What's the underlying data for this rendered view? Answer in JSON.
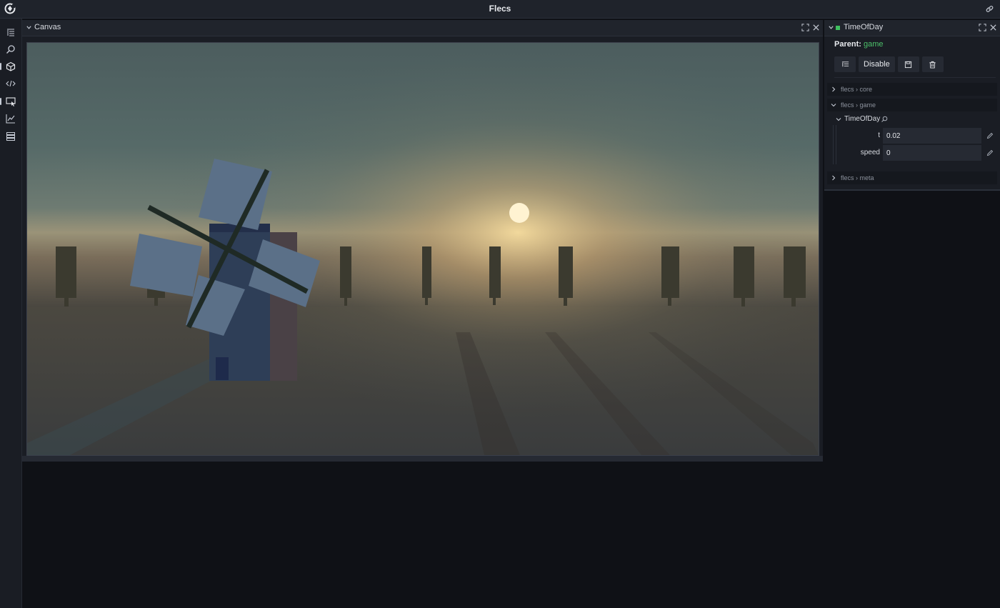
{
  "app": {
    "title": "Flecs"
  },
  "sidebar": {
    "items": [
      {
        "name": "tree-icon"
      },
      {
        "name": "search-icon"
      },
      {
        "name": "cube-icon",
        "active": true
      },
      {
        "name": "code-icon"
      },
      {
        "name": "cursor-icon",
        "active": true
      },
      {
        "name": "chart-icon"
      },
      {
        "name": "list-icon"
      }
    ]
  },
  "canvas_panel": {
    "title": "Canvas"
  },
  "inspector": {
    "title": "TimeOfDay",
    "status_color": "#3fbf5f",
    "parent_label": "Parent:",
    "parent_value": "game",
    "toolbar": {
      "disable_label": "Disable"
    },
    "sections": [
      {
        "module": "flecs",
        "name": "core",
        "expanded": false
      },
      {
        "module": "flecs",
        "name": "game",
        "expanded": true
      },
      {
        "module": "flecs",
        "name": "meta",
        "expanded": false
      }
    ],
    "section_labels": {
      "core": "flecs › core",
      "game": "flecs › game",
      "meta": "flecs › meta"
    },
    "component": {
      "name": "TimeOfDay",
      "fields": [
        {
          "label": "t",
          "value": "0.02"
        },
        {
          "label": "speed",
          "value": "0"
        }
      ]
    }
  },
  "colors": {
    "accent_green": "#4cc06a",
    "background": "#0f1116",
    "panel": "#1a1d24"
  }
}
